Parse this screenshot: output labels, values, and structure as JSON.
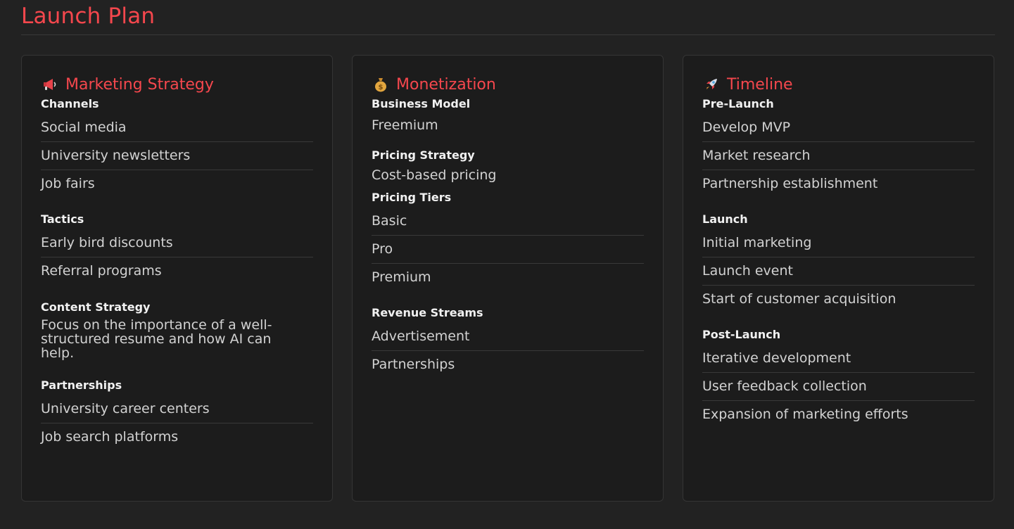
{
  "header": {
    "title": "Launch Plan"
  },
  "marketing": {
    "title": "Marketing Strategy",
    "icon": "megaphone-icon",
    "channels": {
      "title": "Channels",
      "items": [
        "Social media",
        "University newsletters",
        "Job fairs"
      ]
    },
    "tactics": {
      "title": "Tactics",
      "items": [
        "Early bird discounts",
        "Referral programs"
      ]
    },
    "content": {
      "title": "Content Strategy",
      "text": "Focus on the importance of a well-structured resume and how AI can help."
    },
    "partnerships": {
      "title": "Partnerships",
      "items": [
        "University career centers",
        "Job search platforms"
      ]
    }
  },
  "monetization": {
    "title": "Monetization",
    "icon": "money-bag-icon",
    "business_model": {
      "title": "Business Model",
      "value": "Freemium"
    },
    "pricing_strategy": {
      "title": "Pricing Strategy",
      "value": "Cost-based pricing"
    },
    "pricing_tiers": {
      "title": "Pricing Tiers",
      "items": [
        "Basic",
        "Pro",
        "Premium"
      ]
    },
    "revenue_streams": {
      "title": "Revenue Streams",
      "items": [
        "Advertisement",
        "Partnerships"
      ]
    }
  },
  "timeline": {
    "title": "Timeline",
    "icon": "rocket-icon",
    "pre_launch": {
      "title": "Pre-Launch",
      "items": [
        "Develop MVP",
        "Market research",
        "Partnership establishment"
      ]
    },
    "launch": {
      "title": "Launch",
      "items": [
        "Initial marketing",
        "Launch event",
        "Start of customer acquisition"
      ]
    },
    "post_launch": {
      "title": "Post-Launch",
      "items": [
        "Iterative development",
        "User feedback collection",
        "Expansion of marketing efforts"
      ]
    }
  },
  "colors": {
    "accent": "#f5474d",
    "background": "#222222",
    "card": "#1c1c1c"
  }
}
